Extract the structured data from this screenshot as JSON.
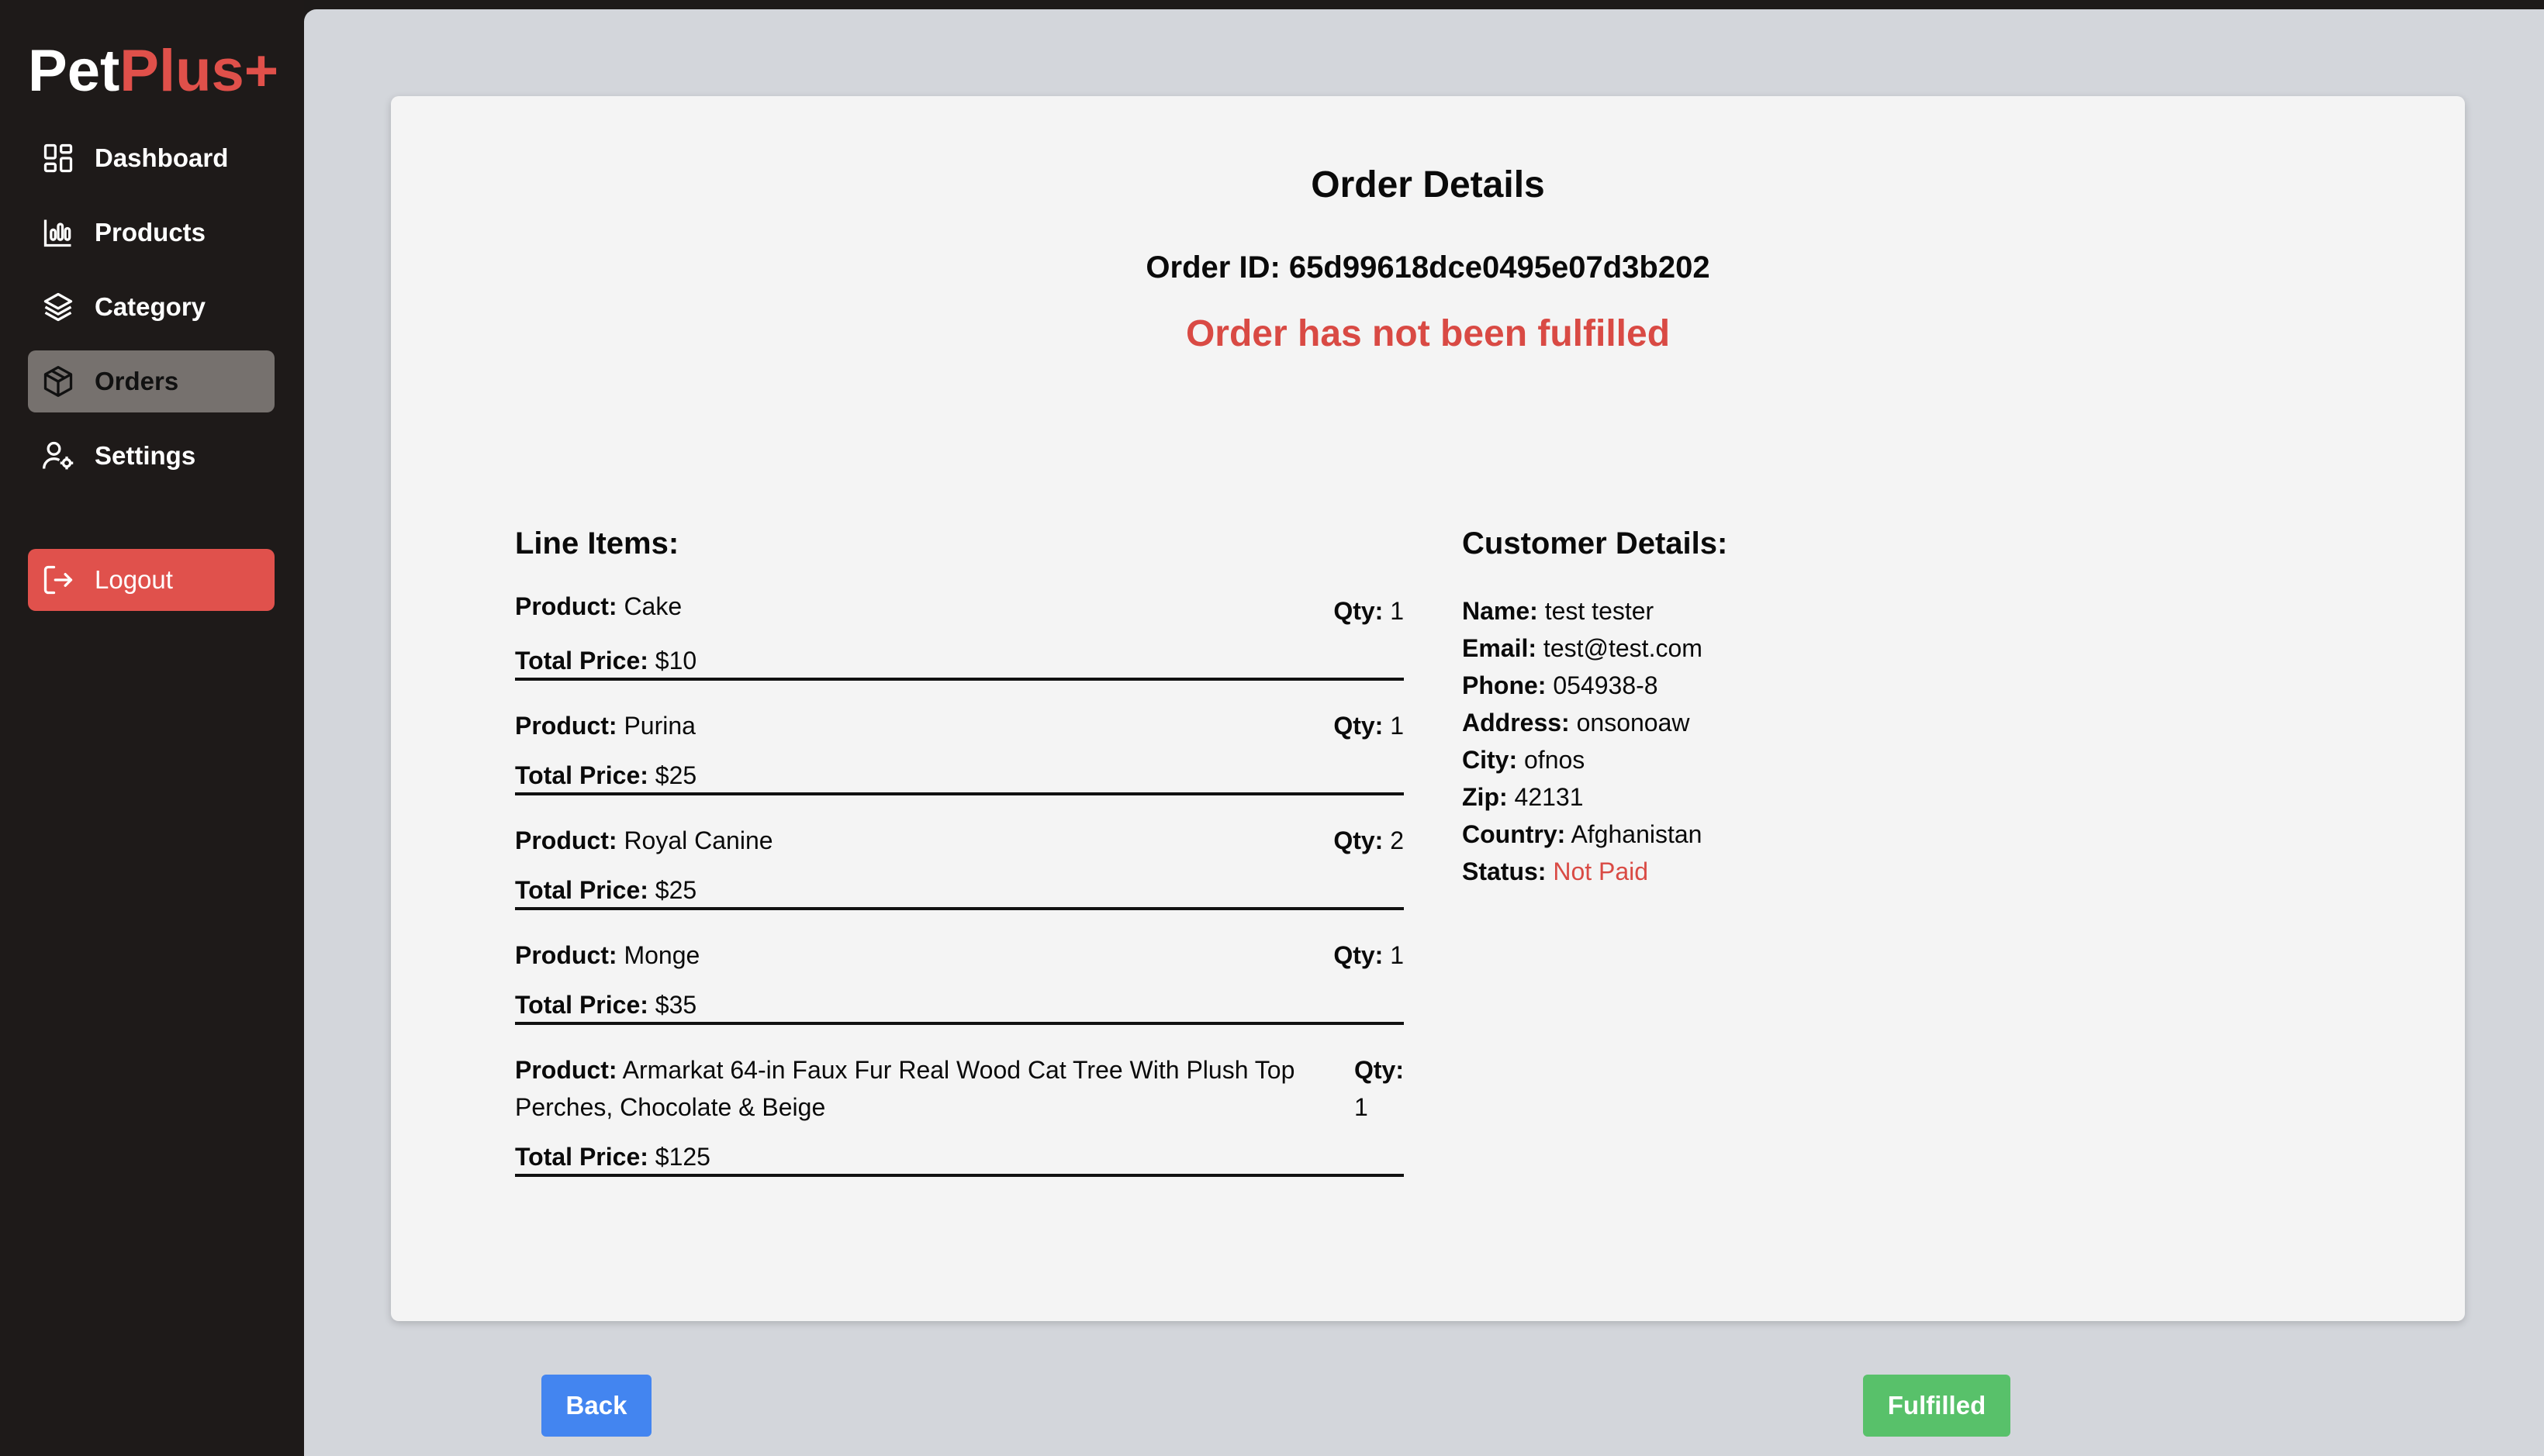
{
  "brand": {
    "part1": "Pet",
    "part2": "Plus+"
  },
  "sidebar": {
    "items": [
      {
        "label": "Dashboard",
        "icon": "dashboard-icon"
      },
      {
        "label": "Products",
        "icon": "bar-chart-icon"
      },
      {
        "label": "Category",
        "icon": "layers-icon"
      },
      {
        "label": "Orders",
        "icon": "box-icon",
        "active": true
      },
      {
        "label": "Settings",
        "icon": "user-settings-icon"
      }
    ],
    "logout": {
      "label": "Logout",
      "icon": "logout-icon"
    }
  },
  "order": {
    "title": "Order Details",
    "id_label": "Order ID:",
    "id_value": "65d99618dce0495e07d3b202",
    "status_message": "Order has not been fulfilled"
  },
  "line_items": {
    "heading": "Line Items:",
    "product_label": "Product:",
    "qty_label": "Qty:",
    "price_label": "Total Price:",
    "items": [
      {
        "product": "Cake",
        "qty": "1",
        "price": "$10"
      },
      {
        "product": "Purina",
        "qty": "1",
        "price": "$25"
      },
      {
        "product": "Royal Canine",
        "qty": "2",
        "price": "$25"
      },
      {
        "product": "Monge",
        "qty": "1",
        "price": "$35"
      },
      {
        "product": "Armarkat 64-in Faux Fur Real Wood Cat Tree With Plush Top Perches, Chocolate & Beige",
        "qty": "1",
        "price": "$125"
      }
    ]
  },
  "customer": {
    "heading": "Customer Details:",
    "fields": [
      {
        "label": "Name:",
        "value": "test tester"
      },
      {
        "label": "Email:",
        "value": "test@test.com"
      },
      {
        "label": "Phone:",
        "value": "054938-8"
      },
      {
        "label": "Address:",
        "value": "onsonoaw"
      },
      {
        "label": "City:",
        "value": "ofnos"
      },
      {
        "label": "Zip:",
        "value": "42131"
      },
      {
        "label": "Country:",
        "value": "Afghanistan"
      },
      {
        "label": "Status:",
        "value": "Not Paid"
      }
    ]
  },
  "actions": {
    "back_label": "Back",
    "fulfilled_label": "Fulfilled"
  },
  "colors": {
    "accent_red": "#e0504a",
    "sidebar_bg": "#1e1a19",
    "back_blue": "#4385f0",
    "fulfilled_green": "#58c16a"
  }
}
